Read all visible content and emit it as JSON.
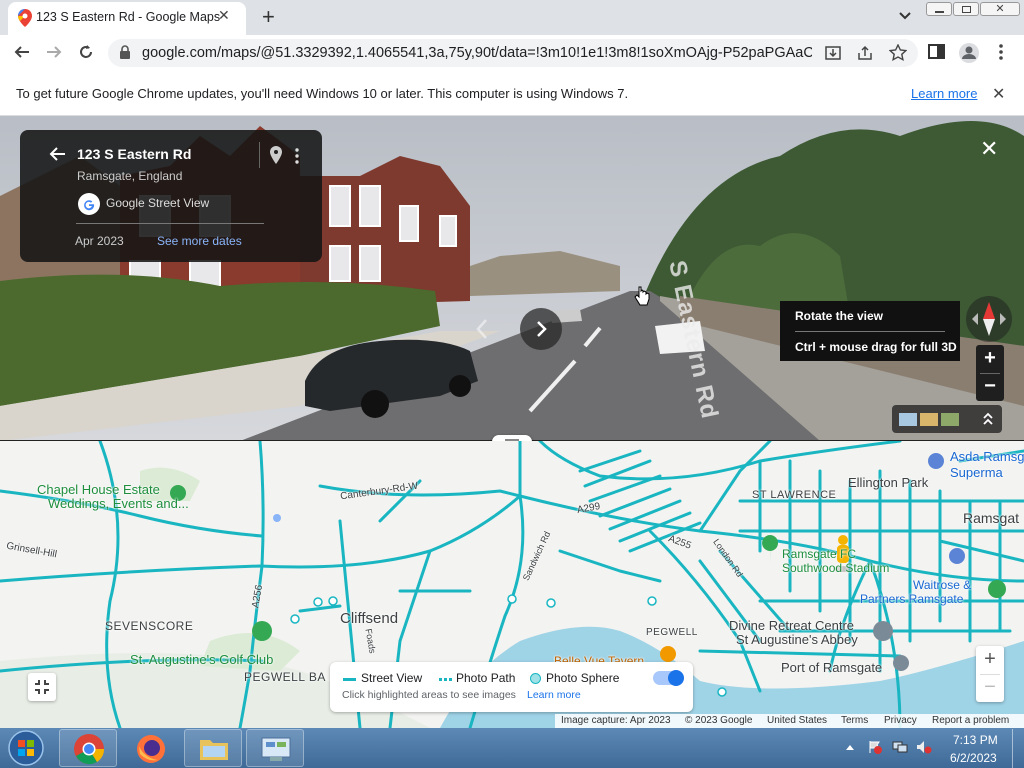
{
  "browser": {
    "tab_title": "123 S Eastern Rd - Google Maps",
    "tab_close": "✕",
    "new_tab": "+",
    "url": "google.com/maps/@51.3329392,1.4065541,3a,75y,90t/data=!3m10!1e1!3m8!1soXmOAjg-P52paPGAaCCBF...",
    "infobar_text": "To get future Google Chrome updates, you'll need Windows 10 or later. This computer is using Windows 7.",
    "infobar_link": "Learn more",
    "infobar_close": "✕"
  },
  "street_view": {
    "title": "123 S Eastern Rd",
    "subtitle": "Ramsgate, England",
    "source": "Google Street View",
    "date": "Apr 2023",
    "see_more": "See more dates",
    "close": "✕",
    "tooltip_line1": "Rotate the view",
    "tooltip_line2": "Ctrl + mouse drag for full 3D",
    "zoom_in": "+",
    "zoom_out": "−",
    "road_text": "S Eastern Rd"
  },
  "map": {
    "labels": [
      {
        "text": "Chapel House Estate"
      },
      {
        "text": "Weddings, Events and..."
      },
      {
        "text": "Canterbury-Rd-W"
      },
      {
        "text": "Ellington Park"
      },
      {
        "text": "Asda Ramsg"
      },
      {
        "text": "Superma"
      },
      {
        "text": "ST LAWRENCE"
      },
      {
        "text": "Ramsgat"
      },
      {
        "text": "A299"
      },
      {
        "text": "A255"
      },
      {
        "text": "A256"
      },
      {
        "text": "Grinsell-Hill"
      },
      {
        "text": "SEVENSCORE"
      },
      {
        "text": "Cliffsend"
      },
      {
        "text": "St. Augustine's Golf Club"
      },
      {
        "text": "PEGWELL BA"
      },
      {
        "text": "PEGWELL"
      },
      {
        "text": "Belle Vue Tavern"
      },
      {
        "text": "Divine Retreat Centre"
      },
      {
        "text": "St Augustine's Abbey"
      },
      {
        "text": "Port of Ramsgate"
      },
      {
        "text": "Ramsgate FC"
      },
      {
        "text": "Southwood Stadium"
      },
      {
        "text": "Waitrose &"
      },
      {
        "text": "Partners Ramsgate"
      },
      {
        "text": "London Rd"
      },
      {
        "text": "Sandwich Rd"
      },
      {
        "text": "Foads"
      }
    ],
    "legend_street_view": "Street View",
    "legend_photo_path": "Photo Path",
    "legend_photo_sphere": "Photo Sphere",
    "legend_hint": "Click highlighted areas to see images",
    "legend_learn_more": "Learn more",
    "zoom_in": "+",
    "zoom_out": "−",
    "footer_capture": "Image capture: Apr 2023",
    "footer_copyright": "© 2023 Google",
    "footer_country": "United States",
    "footer_terms": "Terms",
    "footer_privacy": "Privacy",
    "footer_report": "Report a problem"
  },
  "taskbar": {
    "time": "7:13 PM",
    "date": "6/2/2023"
  },
  "colors": {
    "route": "#19b6c2",
    "link": "#1a73e8",
    "taskbar": "#4d7aa8"
  }
}
